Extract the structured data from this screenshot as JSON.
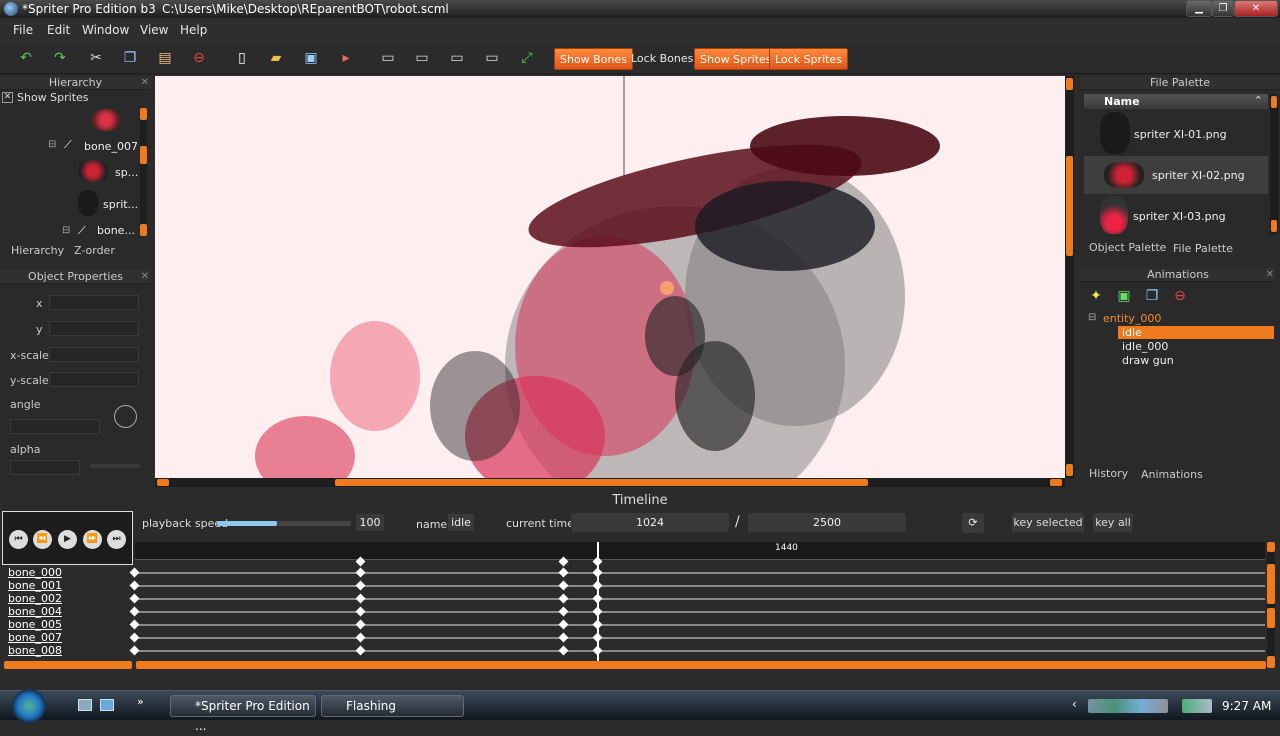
{
  "window": {
    "title": "*Spriter Pro Edition b3",
    "path": "C:\\Users\\Mike\\Desktop\\REparentBOT\\robot.scml"
  },
  "menu": [
    "File",
    "Edit",
    "Window",
    "View",
    "Help"
  ],
  "toolbar": {
    "show_bones": "Show Bones",
    "lock_bones": "Lock Bones",
    "show_sprites": "Show Sprites",
    "lock_sprites": "Lock Sprites"
  },
  "hierarchy": {
    "title": "Hierarchy",
    "show_sprites": "Show Sprites",
    "items": [
      "bone_007",
      "sp...",
      "sprit...",
      "bone..."
    ],
    "tabs": [
      "Hierarchy",
      "Z-order"
    ]
  },
  "object_properties": {
    "title": "Object Properties",
    "labels": [
      "x",
      "y",
      "x-scale",
      "y-scale",
      "angle",
      "alpha"
    ]
  },
  "file_palette": {
    "title": "File Palette",
    "column": "Name",
    "files": [
      "spriter XI-01.png",
      "spriter XI-02.png",
      "spriter XI-03.png"
    ],
    "tabs": [
      "Object Palette",
      "File Palette"
    ]
  },
  "animations": {
    "title": "Animations",
    "entity": "entity_000",
    "items": [
      "idle",
      "idle_000",
      "draw gun"
    ],
    "tabs": [
      "History",
      "Animations"
    ]
  },
  "timeline": {
    "title": "Timeline",
    "playback_label": "playback speed",
    "playback_value": "100",
    "playback_fraction": 0.45,
    "name_label": "name",
    "name_value": "idle",
    "current_time_label": "current time:",
    "current_time": "1024",
    "separator": "/",
    "total_time": "2500",
    "key_selected": "key selected",
    "key_all": "key all",
    "ruler_mark": "1440",
    "tracks": [
      "bone_000",
      "bone_001",
      "bone_002",
      "bone_004",
      "bone_005",
      "bone_007",
      "bone_008"
    ]
  },
  "taskbar": {
    "items": [
      "*Spriter Pro Edition ...",
      "Flashing"
    ],
    "clock": "9:27 AM"
  },
  "colors": {
    "accent": "#f07a1e",
    "viewport_bg": "#fdeef0"
  }
}
